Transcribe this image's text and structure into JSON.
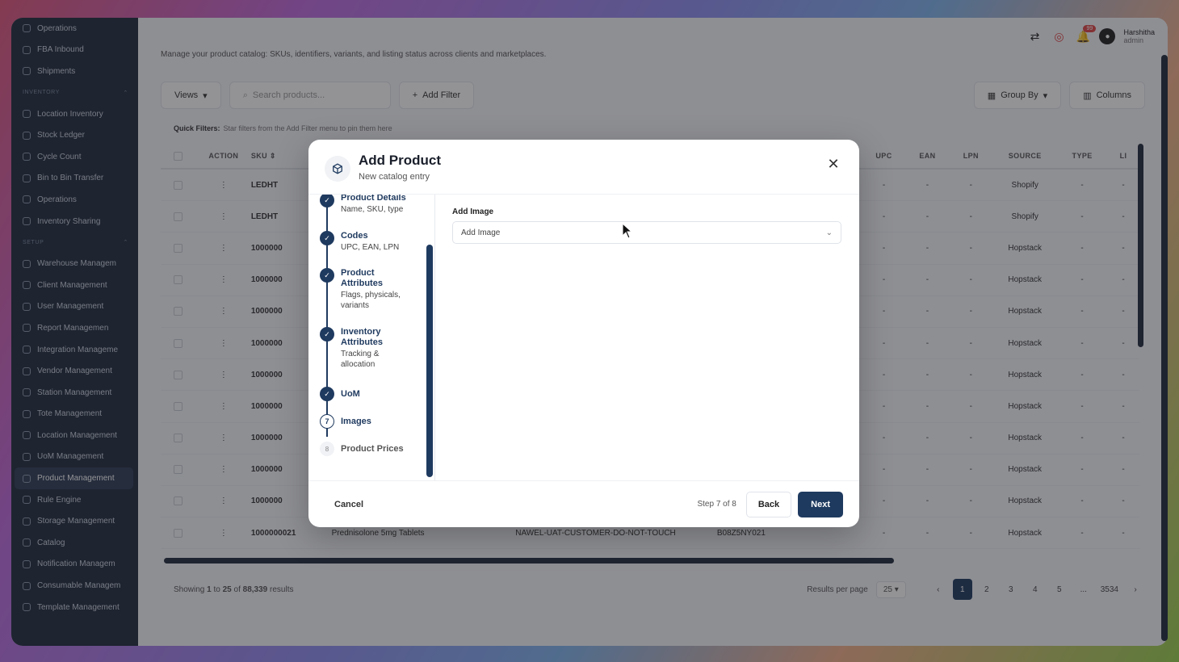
{
  "sidebar": {
    "items_top": [
      "Operations",
      "FBA Inbound",
      "Shipments"
    ],
    "section_inventory": "INVENTORY",
    "items_inventory": [
      "Location Inventory",
      "Stock Ledger",
      "Cycle Count",
      "Bin to Bin Transfer",
      "Operations",
      "Inventory Sharing"
    ],
    "section_setup": "SETUP",
    "items_setup": [
      "Warehouse Managem",
      "Client Management",
      "User Management",
      "Report Managemen",
      "Integration Manageme",
      "Vendor Management",
      "Station Management",
      "Tote Management",
      "Location Management",
      "UoM Management",
      "Product Management",
      "Rule Engine",
      "Storage Management",
      "Catalog",
      "Notification Managem",
      "Consumable Managem",
      "Template Management"
    ]
  },
  "topbar": {
    "badge_count": "99",
    "user_name": "Harshitha",
    "user_role": "admin"
  },
  "page": {
    "subtitle": "Manage your product catalog: SKUs, identifiers, variants, and listing status across clients and marketplaces.",
    "views_label": "Views",
    "search_placeholder": "Search products...",
    "add_filter_label": "Add Filter",
    "group_by_label": "Group By",
    "columns_label": "Columns",
    "quick_filters_label": "Quick Filters:",
    "quick_filters_hint": "Star filters from the Add Filter menu to pin them here"
  },
  "table": {
    "headers": [
      "ACTION",
      "SKU",
      "UPC",
      "EAN",
      "LPN",
      "SOURCE",
      "TYPE",
      "LI"
    ],
    "rows": [
      {
        "sku": "LEDHT",
        "name": "",
        "cust": "",
        "asin": "",
        "upc": "-",
        "ean": "-",
        "lpn": "-",
        "src": "Shopify",
        "type": "-",
        "li": "-"
      },
      {
        "sku": "LEDHT",
        "name": "",
        "cust": "",
        "asin": "",
        "upc": "-",
        "ean": "-",
        "lpn": "-",
        "src": "Shopify",
        "type": "-",
        "li": "-"
      },
      {
        "sku": "1000000",
        "name": "",
        "cust": "",
        "asin": "",
        "upc": "-",
        "ean": "-",
        "lpn": "-",
        "src": "Hopstack",
        "type": "-",
        "li": "-"
      },
      {
        "sku": "1000000",
        "name": "",
        "cust": "",
        "asin": "",
        "upc": "-",
        "ean": "-",
        "lpn": "-",
        "src": "Hopstack",
        "type": "-",
        "li": "-"
      },
      {
        "sku": "1000000",
        "name": "",
        "cust": "",
        "asin": "",
        "upc": "-",
        "ean": "-",
        "lpn": "-",
        "src": "Hopstack",
        "type": "-",
        "li": "-"
      },
      {
        "sku": "1000000",
        "name": "",
        "cust": "",
        "asin": "",
        "upc": "-",
        "ean": "-",
        "lpn": "-",
        "src": "Hopstack",
        "type": "-",
        "li": "-"
      },
      {
        "sku": "1000000",
        "name": "",
        "cust": "",
        "asin": "",
        "upc": "-",
        "ean": "-",
        "lpn": "-",
        "src": "Hopstack",
        "type": "-",
        "li": "-"
      },
      {
        "sku": "1000000",
        "name": "",
        "cust": "",
        "asin": "",
        "upc": "-",
        "ean": "-",
        "lpn": "-",
        "src": "Hopstack",
        "type": "-",
        "li": "-"
      },
      {
        "sku": "1000000",
        "name": "",
        "cust": "",
        "asin": "",
        "upc": "-",
        "ean": "-",
        "lpn": "-",
        "src": "Hopstack",
        "type": "-",
        "li": "-"
      },
      {
        "sku": "1000000",
        "name": "",
        "cust": "",
        "asin": "",
        "upc": "-",
        "ean": "-",
        "lpn": "-",
        "src": "Hopstack",
        "type": "-",
        "li": "-"
      },
      {
        "sku": "1000000",
        "name": "",
        "cust": "",
        "asin": "",
        "upc": "-",
        "ean": "-",
        "lpn": "-",
        "src": "Hopstack",
        "type": "-",
        "li": "-"
      },
      {
        "sku": "1000000021",
        "name": "Prednisolone 5mg Tablets",
        "cust": "NAWEL-UAT-CUSTOMER-DO-NOT-TOUCH",
        "asin": "B08Z5NY021",
        "upc": "-",
        "ean": "-",
        "lpn": "-",
        "src": "Hopstack",
        "type": "-",
        "li": "-"
      }
    ]
  },
  "footer": {
    "showing_prefix": "Showing",
    "from": "1",
    "to_word": "to",
    "to": "25",
    "of_word": "of",
    "total": "88,339",
    "results_word": "results",
    "results_per_page_label": "Results per page",
    "per_page": "25",
    "pages": [
      "1",
      "2",
      "3",
      "4",
      "5",
      "...",
      "3534"
    ]
  },
  "modal": {
    "title": "Add Product",
    "subtitle": "New catalog entry",
    "steps": [
      {
        "num": "1",
        "title": "Product Details",
        "desc": "Name, SKU, type",
        "state": "done"
      },
      {
        "num": "2",
        "title": "Codes",
        "desc": "UPC, EAN, LPN",
        "state": "done"
      },
      {
        "num": "3",
        "title": "Product Attributes",
        "desc": "Flags, physicals, variants",
        "state": "done"
      },
      {
        "num": "4",
        "title": "Inventory Attributes",
        "desc": "Tracking & allocation",
        "state": "done"
      },
      {
        "num": "5",
        "title": "UoM",
        "desc": "",
        "state": "done"
      },
      {
        "num": "7",
        "title": "Images",
        "desc": "",
        "state": "current"
      },
      {
        "num": "8",
        "title": "Product Prices",
        "desc": "",
        "state": "todo"
      }
    ],
    "field_label": "Add Image",
    "select_value": "Add Image",
    "cancel_label": "Cancel",
    "step_info": "Step 7 of 8",
    "back_label": "Back",
    "next_label": "Next"
  },
  "colors": {
    "primary": "#1f3a5f",
    "sidebar": "#1f2b3d",
    "badge": "#e04343"
  }
}
